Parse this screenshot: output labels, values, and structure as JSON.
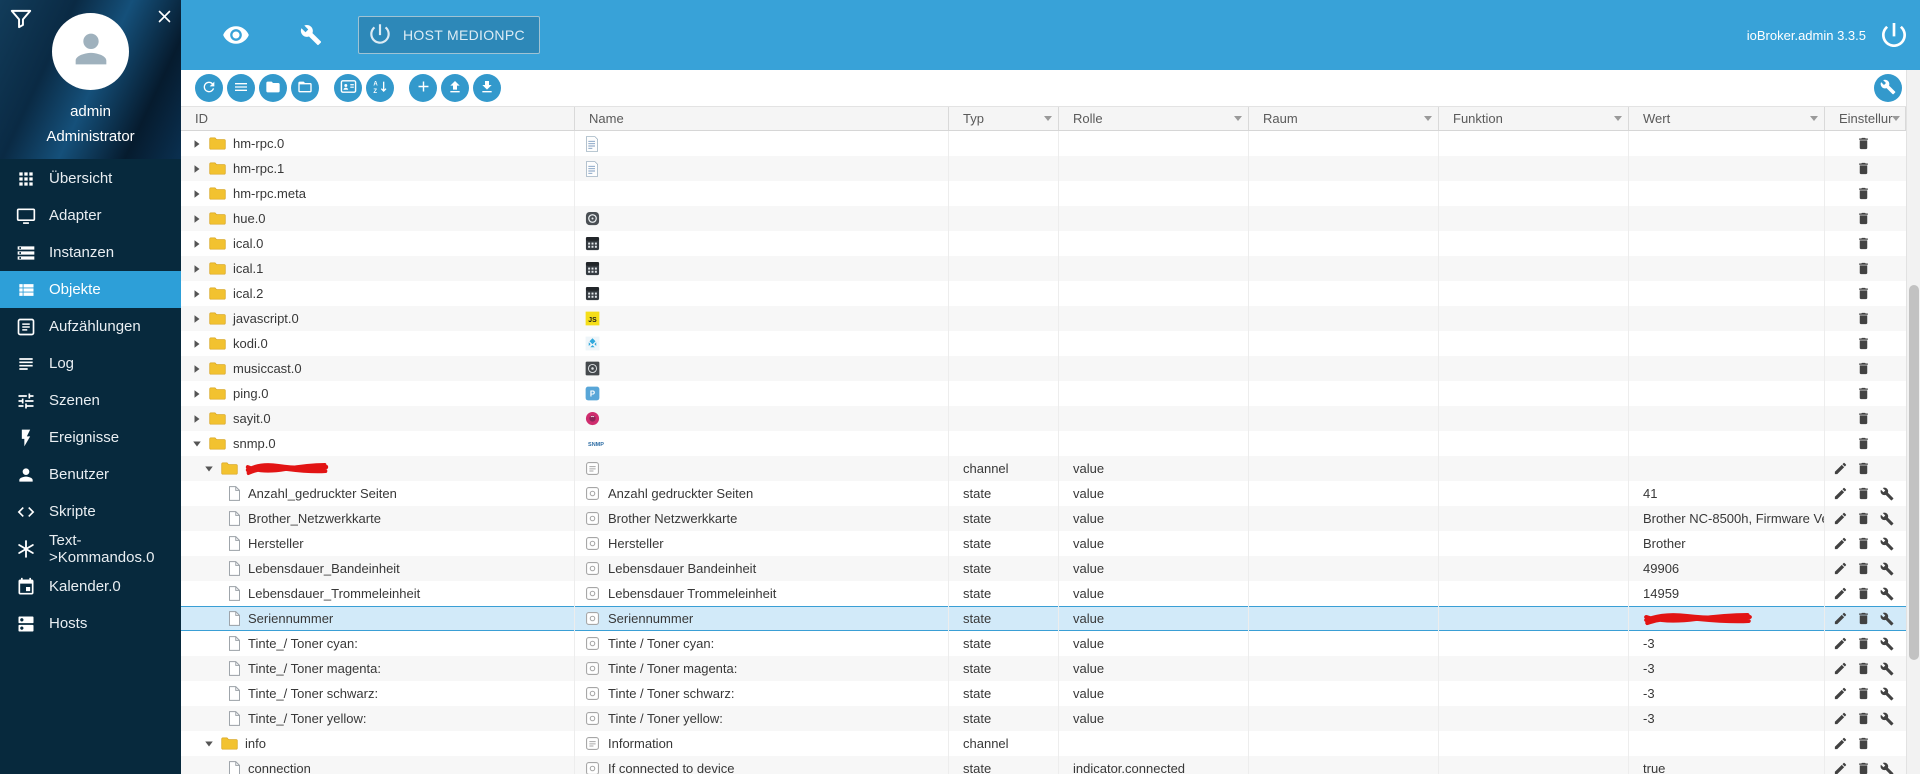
{
  "colors": {
    "top_bar": "#38a2d8",
    "sidebar": "#07293d",
    "active_item": "#2d9fd8",
    "toolbar_button": "#3399cc",
    "selected_row": "#d2eaf9",
    "redaction": "#e21414"
  },
  "topbar": {
    "left_icons": [
      "eye",
      "wrench"
    ],
    "host_button_icon": "power",
    "host_button_label": "HOST MEDIONPC",
    "version_label": "ioBroker.admin 3.3.5",
    "logo_icon": "power"
  },
  "user": {
    "name": "admin",
    "role": "Administrator",
    "icons": [
      "filter-funnel",
      "close"
    ]
  },
  "sidebar": {
    "items": [
      {
        "label": "Übersicht",
        "icon": "overview",
        "selected": false
      },
      {
        "label": "Adapter",
        "icon": "adapter",
        "selected": false
      },
      {
        "label": "Instanzen",
        "icon": "instances",
        "selected": false
      },
      {
        "label": "Objekte",
        "icon": "objects",
        "selected": true
      },
      {
        "label": "Aufzählungen",
        "icon": "enums",
        "selected": false
      },
      {
        "label": "Log",
        "icon": "log",
        "selected": false
      },
      {
        "label": "Szenen",
        "icon": "scenes",
        "selected": false
      },
      {
        "label": "Ereignisse",
        "icon": "events",
        "selected": false
      },
      {
        "label": "Benutzer",
        "icon": "users",
        "selected": false
      },
      {
        "label": "Skripte",
        "icon": "scripts",
        "selected": false
      },
      {
        "label": "Text->Kommandos.0",
        "icon": "text-commands",
        "selected": false
      },
      {
        "label": "Kalender.0",
        "icon": "calendar",
        "selected": false
      },
      {
        "label": "Hosts",
        "icon": "hosts",
        "selected": false
      }
    ]
  },
  "toolbar": {
    "buttons": [
      {
        "icon": "refresh"
      },
      {
        "icon": "list"
      },
      {
        "icon": "folder"
      },
      {
        "icon": "folder-open"
      },
      {
        "icon": "id-card"
      },
      {
        "icon": "sort-az"
      },
      {
        "icon": "add"
      },
      {
        "icon": "upload"
      },
      {
        "icon": "download"
      }
    ],
    "settings_icon": "wrench"
  },
  "table": {
    "columns": [
      {
        "label": "ID",
        "filter": false
      },
      {
        "label": "Name",
        "filter": false
      },
      {
        "label": "Typ",
        "filter": true
      },
      {
        "label": "Rolle",
        "filter": true
      },
      {
        "label": "Raum",
        "filter": true
      },
      {
        "label": "Funktion",
        "filter": true
      },
      {
        "label": "Wert",
        "filter": true
      },
      {
        "label": "Einstellur",
        "filter": true
      }
    ],
    "rows": [
      {
        "id": "hm-rpc.0",
        "level": 1,
        "expander": "collapsed",
        "icon": "hm",
        "actions": "t"
      },
      {
        "id": "hm-rpc.1",
        "level": 1,
        "expander": "collapsed",
        "icon": "hm",
        "actions": "t"
      },
      {
        "id": "hm-rpc.meta",
        "level": 1,
        "expander": "collapsed",
        "actions": "t"
      },
      {
        "id": "hue.0",
        "level": 1,
        "expander": "collapsed",
        "icon": "hue",
        "actions": "t"
      },
      {
        "id": "ical.0",
        "level": 1,
        "expander": "collapsed",
        "icon": "ical",
        "actions": "t"
      },
      {
        "id": "ical.1",
        "level": 1,
        "expander": "collapsed",
        "icon": "ical",
        "actions": "t"
      },
      {
        "id": "ical.2",
        "level": 1,
        "expander": "collapsed",
        "icon": "ical",
        "actions": "t"
      },
      {
        "id": "javascript.0",
        "level": 1,
        "expander": "collapsed",
        "icon": "js",
        "actions": "t"
      },
      {
        "id": "kodi.0",
        "level": 1,
        "expander": "collapsed",
        "icon": "kodi",
        "actions": "t"
      },
      {
        "id": "musiccast.0",
        "level": 1,
        "expander": "collapsed",
        "icon": "musiccast",
        "actions": "t"
      },
      {
        "id": "ping.0",
        "level": 1,
        "expander": "collapsed",
        "icon": "ping",
        "actions": "t"
      },
      {
        "id": "sayit.0",
        "level": 1,
        "expander": "collapsed",
        "icon": "sayit",
        "actions": "t"
      },
      {
        "id": "snmp.0",
        "level": 1,
        "expander": "expanded",
        "icon": "snmp",
        "actions": "t"
      },
      {
        "id": "",
        "redact_id": true,
        "level": 2,
        "expander": "expanded",
        "icon": "channel",
        "typ": "channel",
        "rolle": "value",
        "actions": "et"
      },
      {
        "id": "Anzahl_gedruckter Seiten",
        "level": 3,
        "icon": "state",
        "name": "Anzahl gedruckter Seiten",
        "typ": "state",
        "rolle": "value",
        "wert": "41",
        "actions": "etw"
      },
      {
        "id": "Brother_Netzwerkkarte",
        "level": 3,
        "icon": "state",
        "name": "Brother Netzwerkkarte",
        "typ": "state",
        "rolle": "value",
        "wert": "Brother NC-8500h, Firmware Ve",
        "actions": "etw"
      },
      {
        "id": "Hersteller",
        "level": 3,
        "icon": "state",
        "name": "Hersteller",
        "typ": "state",
        "rolle": "value",
        "wert": "Brother",
        "actions": "etw"
      },
      {
        "id": "Lebensdauer_Bandeinheit",
        "level": 3,
        "icon": "state",
        "name": "Lebensdauer Bandeinheit",
        "typ": "state",
        "rolle": "value",
        "wert": "49906",
        "actions": "etw"
      },
      {
        "id": "Lebensdauer_Trommeleinheit",
        "level": 3,
        "icon": "state",
        "name": "Lebensdauer Trommeleinheit",
        "typ": "state",
        "rolle": "value",
        "wert": "14959",
        "actions": "etw"
      },
      {
        "id": "Seriennummer",
        "level": 3,
        "icon": "state",
        "name": "Seriennummer",
        "typ": "state",
        "rolle": "value",
        "wert": "",
        "redact_wert": true,
        "selected": true,
        "actions": "etw"
      },
      {
        "id": "Tinte_/ Toner cyan:",
        "level": 3,
        "icon": "state",
        "name": "Tinte / Toner cyan:",
        "typ": "state",
        "rolle": "value",
        "wert": "-3",
        "actions": "etw"
      },
      {
        "id": "Tinte_/ Toner magenta:",
        "level": 3,
        "icon": "state",
        "name": "Tinte / Toner magenta:",
        "typ": "state",
        "rolle": "value",
        "wert": "-3",
        "actions": "etw"
      },
      {
        "id": "Tinte_/ Toner schwarz:",
        "level": 3,
        "icon": "state",
        "name": "Tinte / Toner schwarz:",
        "typ": "state",
        "rolle": "value",
        "wert": "-3",
        "actions": "etw"
      },
      {
        "id": "Tinte_/ Toner yellow:",
        "level": 3,
        "icon": "state",
        "name": "Tinte / Toner yellow:",
        "typ": "state",
        "rolle": "value",
        "wert": "-3",
        "actions": "etw"
      },
      {
        "id": "info",
        "level": 2,
        "expander": "expanded",
        "icon": "channel",
        "name": "Information",
        "typ": "channel",
        "actions": "et"
      },
      {
        "id": "connection",
        "level": 3,
        "icon": "state",
        "name": "If connected to device",
        "typ": "state",
        "rolle": "indicator.connected",
        "wert": "true",
        "actions": "etw"
      }
    ]
  }
}
